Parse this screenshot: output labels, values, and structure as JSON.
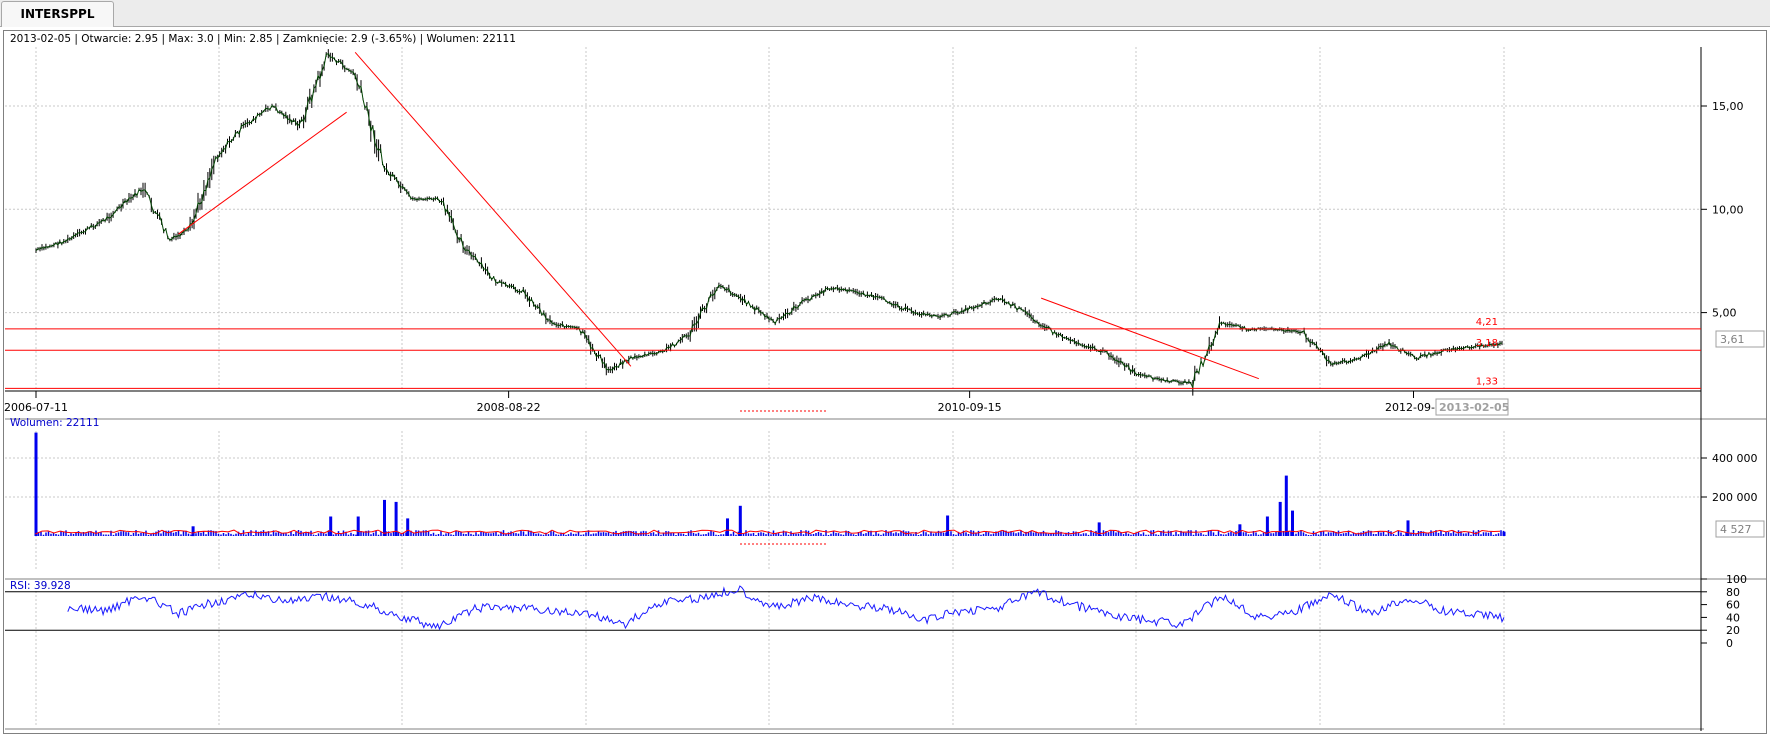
{
  "tab": {
    "label": "INTERSPPL"
  },
  "header_info": "2013-02-05 | Otwarcie: 2.95 | Max: 3.0 | Min: 2.85 | Zamknięcie: 2.9 (-3.65%)  | Wolumen: 22111",
  "price_panel": {
    "y_ticks": [
      "15,00",
      "10,00",
      "5,00"
    ],
    "current_value": "3,61",
    "hline_labels": [
      "4,21",
      "3,18",
      "1,33"
    ],
    "x_ticks": [
      "2006-07-11",
      "2008-08-22",
      "2010-09-15",
      "2012-09-1"
    ],
    "last_date": "2013-02-05"
  },
  "volume_panel": {
    "label": "Wolumen: 22111",
    "y_ticks": [
      "400 000",
      "200 000"
    ],
    "current_value": "4 527"
  },
  "rsi_panel": {
    "label": "RSI: 39.928",
    "y_ticks": [
      "100",
      "80",
      "60",
      "40",
      "20",
      "0"
    ]
  },
  "colors": {
    "price_line": "#004400",
    "candle": "#000000",
    "trend_line": "#ff0000",
    "volume_bar": "#0000ee",
    "volume_ma": "#ff0000",
    "rsi_line": "#1a1aff",
    "grid": "#c8c8c8",
    "tab_bg": "#ececec"
  },
  "chart_data": [
    {
      "type": "line",
      "series": [
        {
          "x": [
            "2006-07-11",
            "2006-09-01",
            "2006-11-01",
            "2007-01-02",
            "2007-02-15",
            "2007-03-20",
            "2007-05-01",
            "2007-06-15",
            "2007-08-01",
            "2007-09-15",
            "2007-11-01",
            "2007-12-15",
            "2008-02-01",
            "2008-03-15",
            "2008-05-01",
            "2008-06-15",
            "2008-08-01",
            "2008-09-15",
            "2008-11-01",
            "2008-12-15",
            "2009-02-01",
            "2009-03-10",
            "2009-05-01",
            "2009-06-15",
            "2009-08-01",
            "2009-09-15",
            "2009-11-01",
            "2009-12-15",
            "2010-02-01",
            "2010-03-15",
            "2010-05-01",
            "2010-06-15",
            "2010-08-01",
            "2010-09-15",
            "2010-11-01",
            "2010-12-15",
            "2011-02-01",
            "2011-03-15",
            "2011-05-01",
            "2011-06-15",
            "2011-08-01",
            "2011-09-15",
            "2011-11-01",
            "2011-12-15",
            "2012-02-01",
            "2012-03-15",
            "2012-05-01",
            "2012-06-15",
            "2012-08-01",
            "2012-09-15",
            "2012-11-01",
            "2013-02-05"
          ],
          "values": [
            8.0,
            8.5,
            9.5,
            11.0,
            8.5,
            9.0,
            12.5,
            14.0,
            15.0,
            14.0,
            17.5,
            16.5,
            12.0,
            10.5,
            10.5,
            8.0,
            6.5,
            6.0,
            4.5,
            4.2,
            2.2,
            2.8,
            3.1,
            4.0,
            6.4,
            5.5,
            4.5,
            5.5,
            6.2,
            6.0,
            5.6,
            5.0,
            4.8,
            5.2,
            5.7,
            5.0,
            4.0,
            3.5,
            3.0,
            2.0,
            1.7,
            1.6,
            4.5,
            4.2,
            4.2,
            4.0,
            2.5,
            2.8,
            3.5,
            2.8,
            3.2,
            3.5
          ]
        },
        {
          "name": "trend",
          "x": [
            "2007-03-01",
            "2007-12-01"
          ],
          "values": [
            8.8,
            14.7
          ]
        },
        {
          "name": "trend",
          "x": [
            "2007-12-15",
            "2009-03-10"
          ],
          "values": [
            17.6,
            2.4
          ]
        },
        {
          "name": "trend",
          "x": [
            "2011-01-10",
            "2012-01-01"
          ],
          "values": [
            5.7,
            1.8
          ]
        },
        {
          "name": "level",
          "x": [
            "2006-07-11",
            "2013-02-05"
          ],
          "values": [
            4.21,
            4.21
          ]
        },
        {
          "name": "level",
          "x": [
            "2006-07-11",
            "2013-02-05"
          ],
          "values": [
            3.18,
            3.18
          ]
        },
        {
          "name": "level",
          "x": [
            "2006-07-11",
            "2013-02-05"
          ],
          "values": [
            1.33,
            1.33
          ]
        }
      ],
      "ylim": [
        1.0,
        18.0
      ],
      "grid": true
    },
    {
      "type": "bar",
      "x": [
        "2006-07-11",
        "2007-03-25",
        "2007-11-05",
        "2007-12-20",
        "2008-02-01",
        "2008-02-20",
        "2008-03-10",
        "2009-08-15",
        "2009-09-05",
        "2010-08-10",
        "2011-04-15",
        "2011-12-01",
        "2012-01-15",
        "2012-02-05",
        "2012-02-15",
        "2012-02-25",
        "2012-09-01",
        "2013-02-05"
      ],
      "values": [
        530000,
        50000,
        100000,
        100000,
        185000,
        175000,
        90000,
        90000,
        155000,
        105000,
        70000,
        60000,
        100000,
        175000,
        310000,
        130000,
        80000,
        22111
      ],
      "ylim": [
        0,
        600000
      ],
      "grid": true
    },
    {
      "type": "line",
      "x": [
        "2006-09-01",
        "2006-11-01",
        "2007-01-02",
        "2007-03-01",
        "2007-05-01",
        "2007-07-01",
        "2007-09-01",
        "2007-11-01",
        "2008-01-01",
        "2008-03-01",
        "2008-05-01",
        "2008-07-01",
        "2008-09-01",
        "2008-11-01",
        "2009-01-01",
        "2009-03-01",
        "2009-05-01",
        "2009-07-01",
        "2009-09-01",
        "2009-11-01",
        "2010-01-01",
        "2010-03-01",
        "2010-05-01",
        "2010-07-01",
        "2010-09-01",
        "2010-11-01",
        "2011-01-01",
        "2011-03-01",
        "2011-05-01",
        "2011-07-01",
        "2011-09-01",
        "2011-11-01",
        "2012-01-01",
        "2012-03-01",
        "2012-05-01",
        "2012-07-01",
        "2012-09-01",
        "2012-11-01",
        "2013-02-05"
      ],
      "values": [
        55,
        50,
        75,
        45,
        65,
        75,
        65,
        72,
        60,
        40,
        25,
        55,
        55,
        50,
        45,
        30,
        65,
        70,
        85,
        55,
        70,
        60,
        55,
        35,
        50,
        55,
        80,
        60,
        45,
        35,
        30,
        75,
        40,
        50,
        75,
        45,
        70,
        50,
        39.928
      ],
      "ylim": [
        0,
        100
      ],
      "grid": true
    }
  ]
}
